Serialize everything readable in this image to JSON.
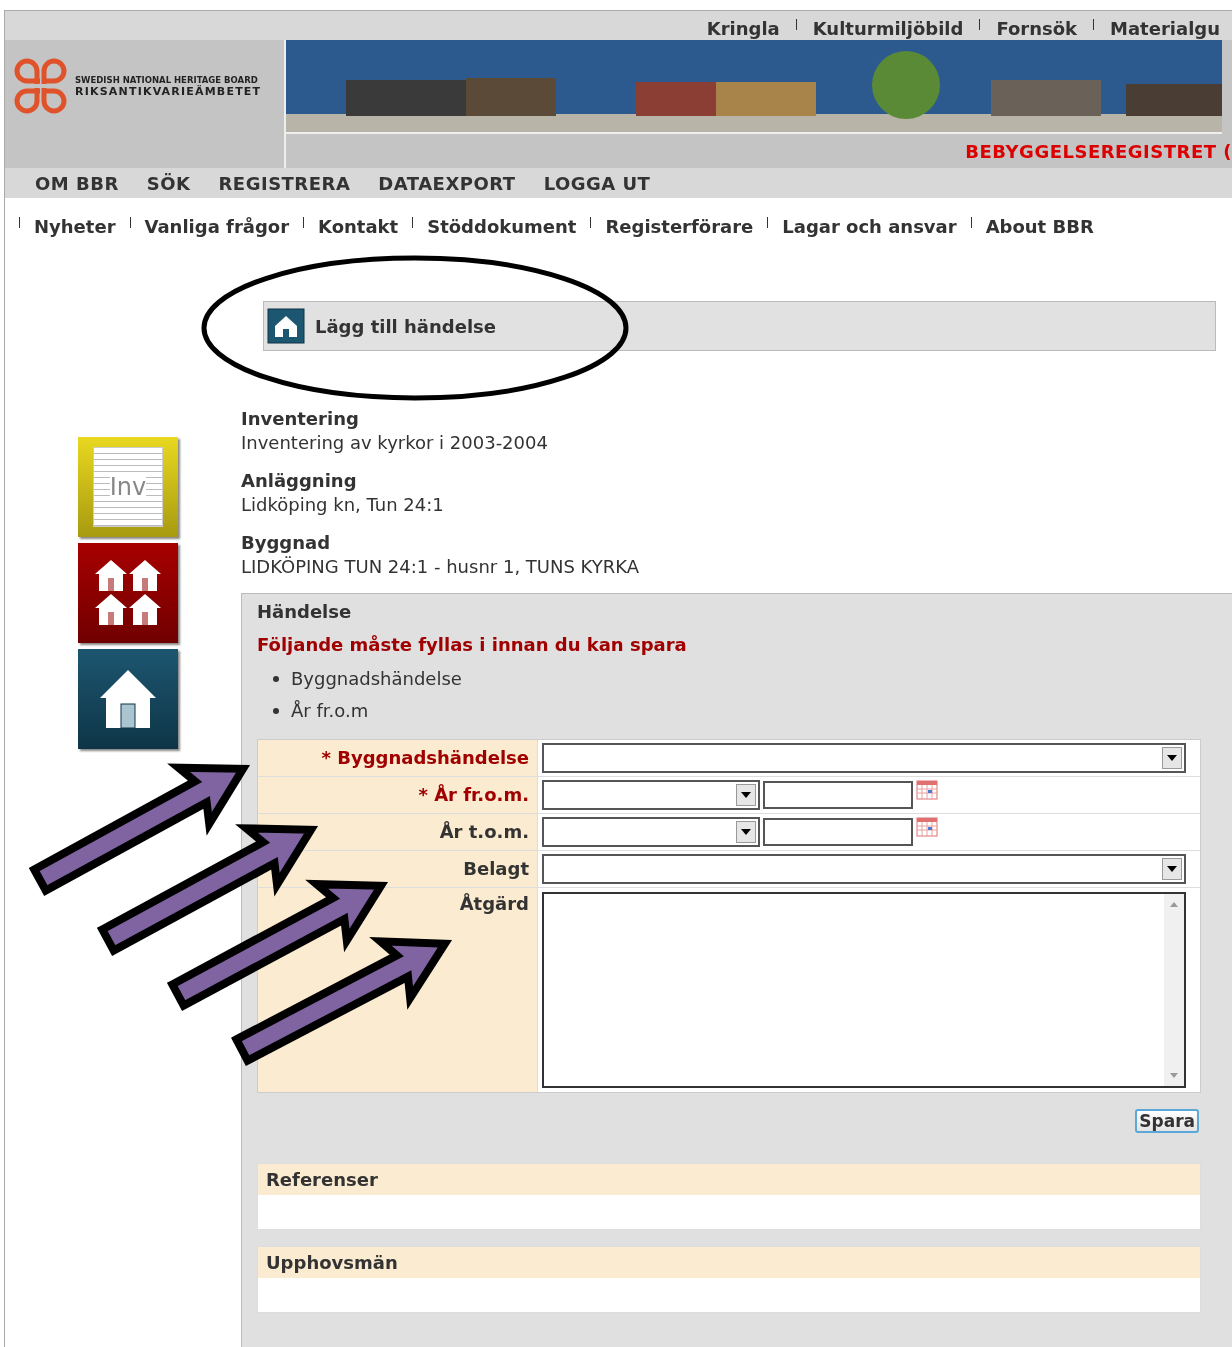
{
  "top_links": [
    "Kringla",
    "Kulturmiljöbild",
    "Fornsök",
    "Materialgu"
  ],
  "logo": {
    "line1": "SWEDISH NATIONAL HERITAGE BOARD",
    "line2": "RIKSANTIKVARIEÄMBETET"
  },
  "site_title": "BEBYGGELSEREGISTRET (",
  "main_nav": [
    "OM BBR",
    "SÖK",
    "REGISTRERA",
    "DATAEXPORT",
    "LOGGA UT"
  ],
  "sub_nav": [
    "Nyheter",
    "Vanliga frågor",
    "Kontakt",
    "Stöddokument",
    "Registerförare",
    "Lagar och ansvar",
    "About BBR"
  ],
  "page_heading": "Lägg till händelse",
  "side_tiles": [
    {
      "kind": "inventory",
      "label": "Inv"
    },
    {
      "kind": "facilities"
    },
    {
      "kind": "building"
    }
  ],
  "info": [
    {
      "label": "Inventering",
      "value": "Inventering av kyrkor i 2003-2004"
    },
    {
      "label": "Anläggning",
      "value": "Lidköping kn, Tun 24:1"
    },
    {
      "label": "Byggnad",
      "value": "LIDKÖPING TUN 24:1 - husnr 1, TUNS KYRKA"
    }
  ],
  "event_panel": {
    "title": "Händelse",
    "error": "Följande måste fyllas i innan du kan spara",
    "missing": [
      "Byggnadshändelse",
      "År fr.o.m"
    ],
    "fields": [
      {
        "label": "* Byggnadshändelse",
        "required": true,
        "kind": "select"
      },
      {
        "label": "* År fr.o.m.",
        "required": true,
        "kind": "year"
      },
      {
        "label": "År t.o.m.",
        "required": false,
        "kind": "year"
      },
      {
        "label": "Belagt",
        "required": false,
        "kind": "select"
      },
      {
        "label": "Åtgärd",
        "required": false,
        "kind": "textarea"
      }
    ],
    "save_button": "Spara"
  },
  "sections": [
    {
      "title": "Referenser"
    },
    {
      "title": "Upphovsmän"
    }
  ]
}
